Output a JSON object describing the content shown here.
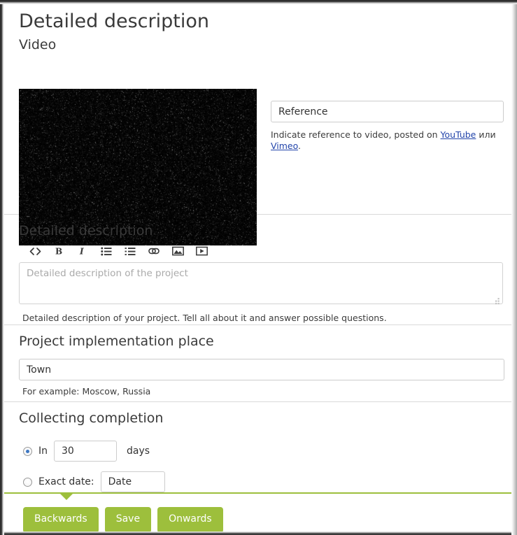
{
  "page": {
    "title": "Detailed description"
  },
  "video": {
    "label": "Video",
    "thumbnail_alt": "video-noise-preview",
    "reference_placeholder": "Reference",
    "reference_value": "",
    "help_prefix": "Indicate reference to video, posted on ",
    "help_link_youtube": "YouTube",
    "help_conjunction": " или ",
    "help_link_vimeo": "Vimeo",
    "help_suffix": "."
  },
  "description": {
    "section_title": "Detailed description",
    "toolbar": [
      {
        "name": "code-icon",
        "label": "<>"
      },
      {
        "name": "bold-icon",
        "label": "B"
      },
      {
        "name": "italic-icon",
        "label": "I"
      },
      {
        "name": "unordered-list-icon",
        "label": "☰"
      },
      {
        "name": "ordered-list-icon",
        "label": "≡"
      },
      {
        "name": "link-icon",
        "label": "∞"
      },
      {
        "name": "image-icon",
        "label": "▣"
      },
      {
        "name": "video-icon",
        "label": "▶"
      }
    ],
    "textarea_placeholder": "Detailed description of the project",
    "textarea_value": "",
    "help": "Detailed description of your project. Tell all about it and answer possible questions."
  },
  "place": {
    "section_title": "Project implementation place",
    "placeholder": "Town",
    "value": "",
    "help": "For example: Moscow, Russia"
  },
  "collecting": {
    "section_title": "Collecting completion",
    "option_in": {
      "label": "In",
      "selected": true,
      "days_value": "30",
      "days_suffix": "days"
    },
    "option_exact": {
      "label": "Exact date:",
      "selected": false,
      "date_placeholder": "Date",
      "date_value": ""
    }
  },
  "footer": {
    "backwards_label": "Backwards",
    "save_label": "Save",
    "onwards_label": "Onwards"
  },
  "colors": {
    "accent_green": "#9dbf3c",
    "link_blue": "#2244aa",
    "radio_blue": "#3d77c2",
    "text": "#333333",
    "divider": "#d9d9d9"
  }
}
